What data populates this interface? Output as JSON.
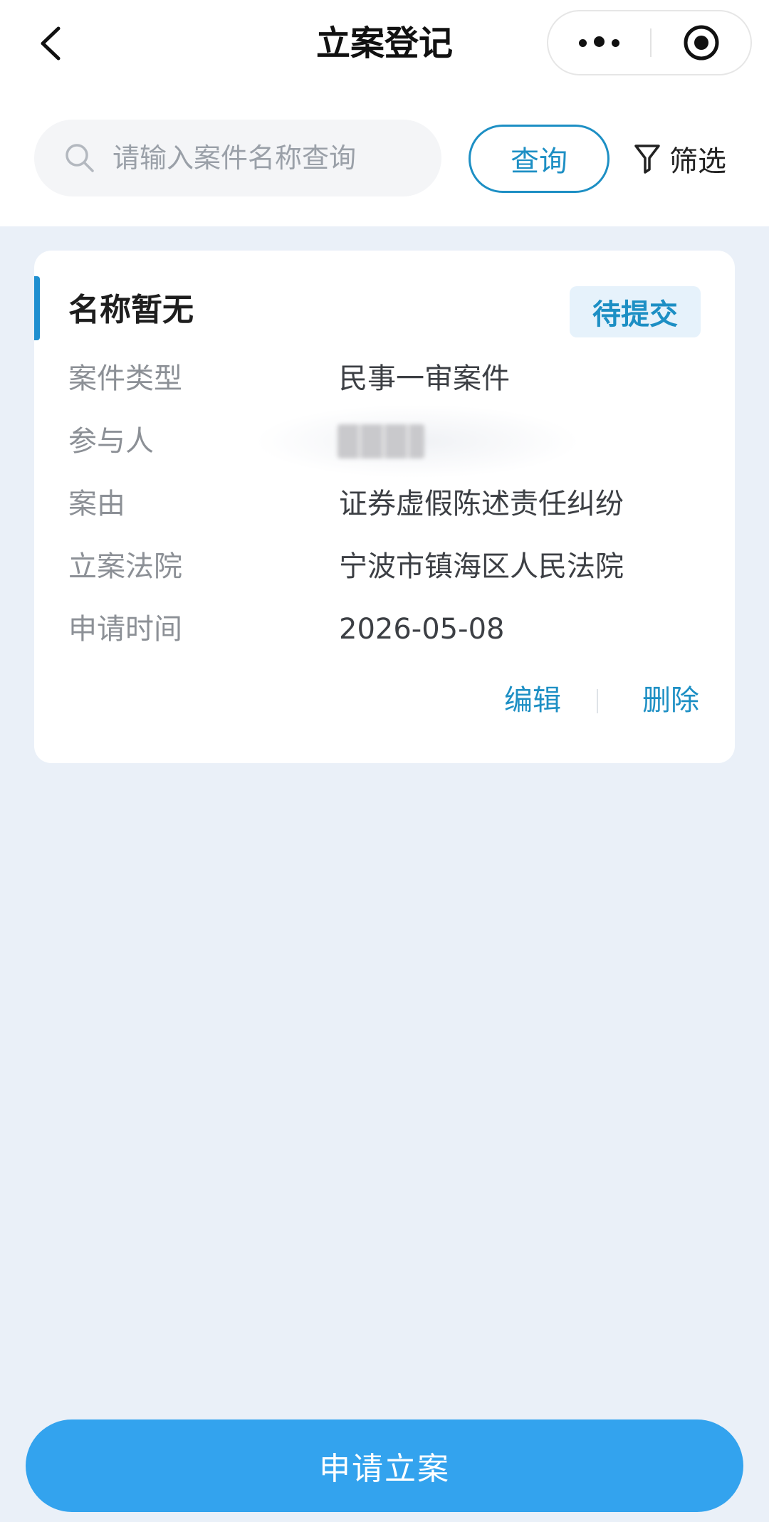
{
  "nav": {
    "title": "立案登记"
  },
  "search": {
    "placeholder": "请输入案件名称查询",
    "query_label": "查询",
    "filter_label": "筛选"
  },
  "card": {
    "title": "名称暂无",
    "status": "待提交",
    "fields": [
      {
        "label": "案件类型",
        "value": "民事一审案件"
      },
      {
        "label": "参与人",
        "value": ""
      },
      {
        "label": "案由",
        "value": "证券虚假陈述责任纠纷"
      },
      {
        "label": "立案法院",
        "value": "宁波市镇海区人民法院"
      },
      {
        "label": "申请时间",
        "value": "2026-05-08"
      }
    ],
    "edit_label": "编辑",
    "delete_label": "删除"
  },
  "footer": {
    "apply_label": "申请立案"
  },
  "colors": {
    "accent": "#1d8fc4",
    "primary_button": "#33a3ee",
    "background": "#eaf0f8"
  }
}
